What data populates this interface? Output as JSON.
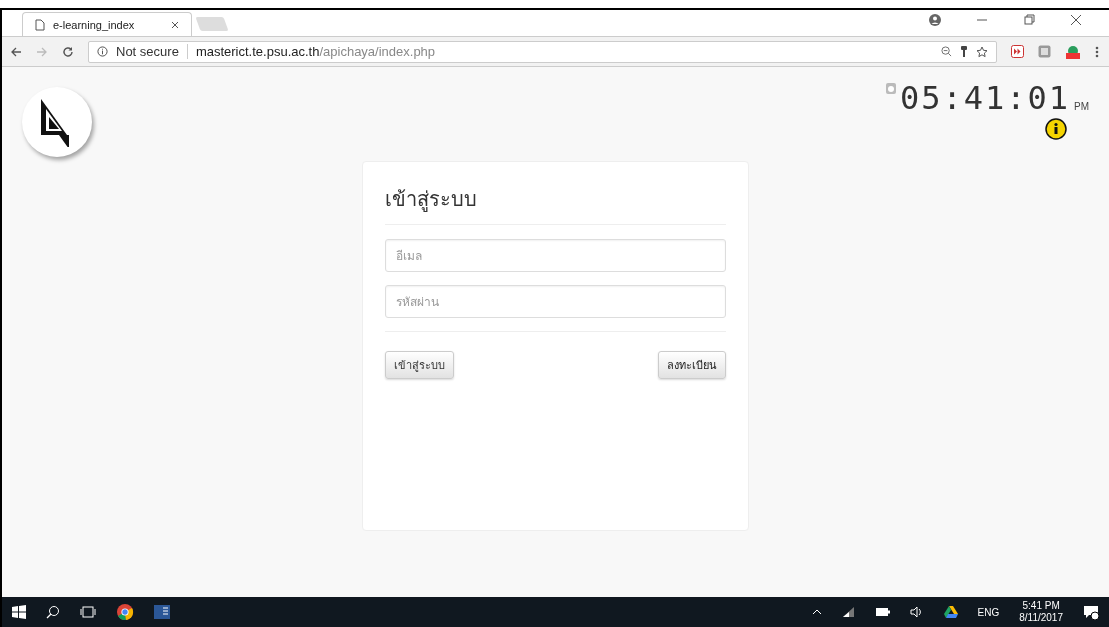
{
  "browser": {
    "tabs": [
      {
        "title": "e-learning_index",
        "selected": true
      }
    ],
    "security": "Not secure",
    "url_host": "masterict.te.psu.ac.th",
    "url_path": "/apichaya/index.php"
  },
  "clock": {
    "time": "05:41:01",
    "period": "PM"
  },
  "login": {
    "title": "เข้าสู่ระบบ",
    "fields": [
      {
        "placeholder": "อีเมล"
      },
      {
        "placeholder": "รหัสผ่าน"
      }
    ],
    "buttons": [
      {
        "label": "เข้าสู่ระบบ",
        "kind": "submit"
      },
      {
        "label": "ลงทะเบียน",
        "kind": "register"
      }
    ]
  },
  "taskbar": {
    "language": "ENG",
    "time": "5:41 PM",
    "date": "8/11/2017"
  }
}
